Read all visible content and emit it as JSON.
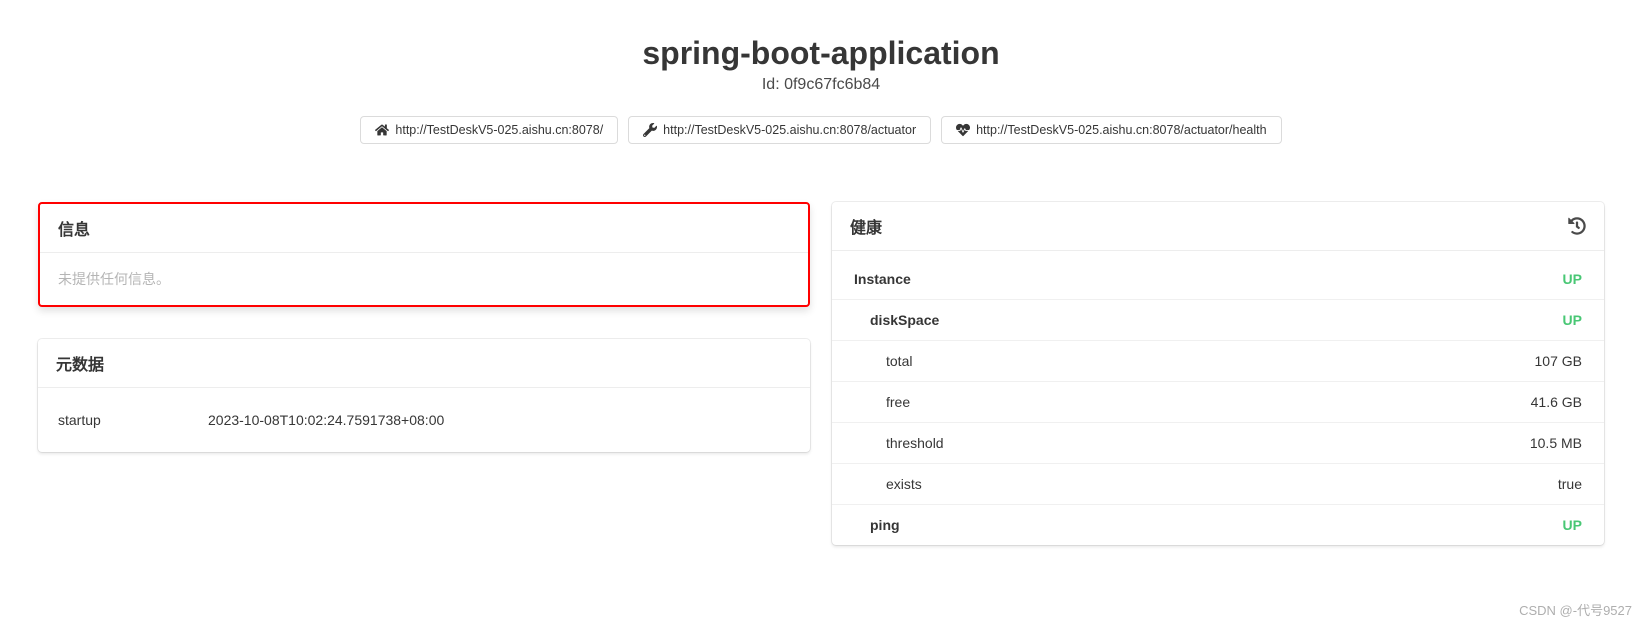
{
  "header": {
    "title": "spring-boot-application",
    "id_label": "Id: 0f9c67fc6b84",
    "urls": [
      {
        "icon": "home",
        "text": "http://TestDeskV5-025.aishu.cn:8078/"
      },
      {
        "icon": "wrench",
        "text": "http://TestDeskV5-025.aishu.cn:8078/actuator"
      },
      {
        "icon": "heartbeat",
        "text": "http://TestDeskV5-025.aishu.cn:8078/actuator/health"
      }
    ]
  },
  "info_card": {
    "title": "信息",
    "empty_text": "未提供任何信息。"
  },
  "metadata_card": {
    "title": "元数据",
    "items": [
      {
        "key": "startup",
        "value": "2023-10-08T10:02:24.7591738+08:00"
      }
    ]
  },
  "health_card": {
    "title": "健康",
    "rows": [
      {
        "label": "Instance",
        "value": "UP",
        "indent": 0,
        "bold": true,
        "status": true
      },
      {
        "label": "diskSpace",
        "value": "UP",
        "indent": 1,
        "bold": true,
        "status": true
      },
      {
        "label": "total",
        "value": "107 GB",
        "indent": 2,
        "bold": false,
        "status": false
      },
      {
        "label": "free",
        "value": "41.6 GB",
        "indent": 2,
        "bold": false,
        "status": false
      },
      {
        "label": "threshold",
        "value": "10.5 MB",
        "indent": 2,
        "bold": false,
        "status": false
      },
      {
        "label": "exists",
        "value": "true",
        "indent": 2,
        "bold": false,
        "status": false
      },
      {
        "label": "ping",
        "value": "UP",
        "indent": 1,
        "bold": true,
        "status": true
      }
    ]
  },
  "watermark": "CSDN @-代号9527"
}
